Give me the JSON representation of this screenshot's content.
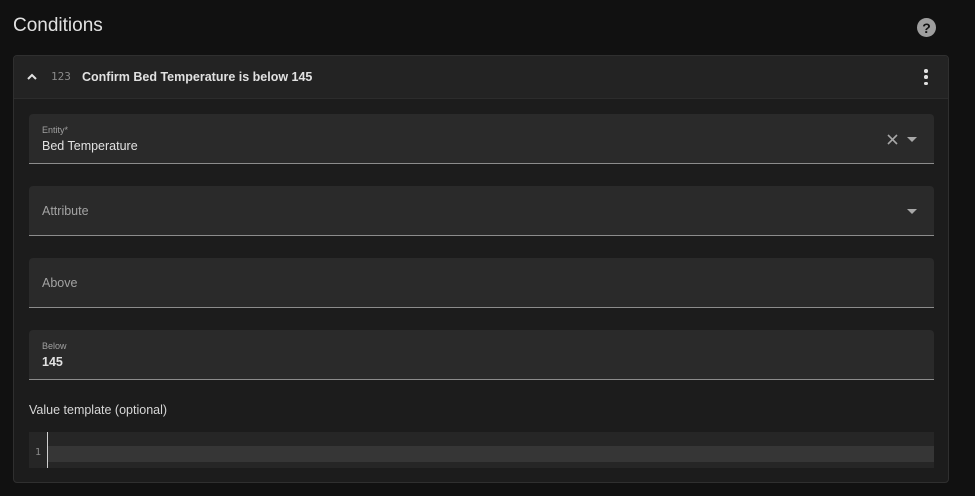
{
  "section": {
    "title": "Conditions",
    "help_icon": "help-circle-icon",
    "help_symbol": "?"
  },
  "condition": {
    "collapse_icon": "chevron-up-icon",
    "type_icon": "numeric-icon",
    "type_icon_text": "123",
    "title": "Confirm Bed Temperature is below 145",
    "menu_icon": "dots-vertical-icon"
  },
  "fields": {
    "entity": {
      "label": "Entity*",
      "value": "Bed Temperature"
    },
    "attribute": {
      "label": "Attribute",
      "value": ""
    },
    "above": {
      "label": "Above",
      "value": ""
    },
    "below": {
      "label": "Below",
      "value": "145"
    }
  },
  "value_template": {
    "label": "Value template (optional)",
    "line_number": "1",
    "content": ""
  },
  "colors": {
    "background": "#111111",
    "card": "#1c1c1c",
    "field": "#2a2a2a",
    "text": "#e1e1e1"
  }
}
